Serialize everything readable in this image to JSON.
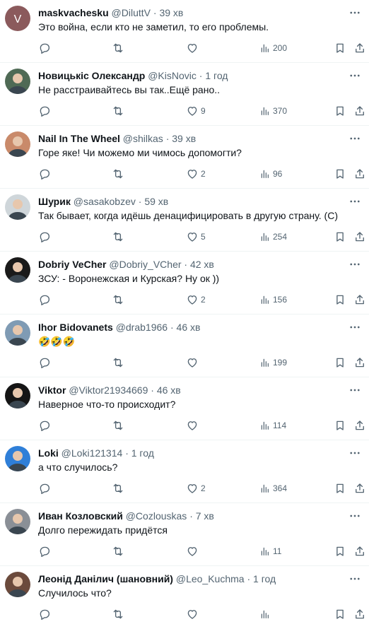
{
  "replies": [
    {
      "name": "maskvachesku",
      "handle": "@DiluttV",
      "sep": "·",
      "time": "39 хв",
      "text": "Это война, если кто не заметил, то его проблемы.",
      "reply_count": "",
      "retweet_count": "",
      "like_count": "",
      "views": "200",
      "avatar_letter": "V",
      "avatar_color": "#8b5a5c"
    },
    {
      "name": "Новицькіс Олександр",
      "handle": "@KisNovic",
      "sep": "·",
      "time": "1 год",
      "text": "Не расстраивайтесь вы так..Ещё рано..",
      "reply_count": "",
      "retweet_count": "",
      "like_count": "9",
      "views": "370",
      "avatar_color": "#4f6a55"
    },
    {
      "name": "Nail In The Wheel",
      "handle": "@shilkas",
      "sep": "·",
      "time": "39 хв",
      "text": "Горе яке! Чи можемо ми чимось допомогти?",
      "reply_count": "",
      "retweet_count": "",
      "like_count": "2",
      "views": "96",
      "avatar_color": "#c98a6a"
    },
    {
      "name": "Шурик",
      "handle": "@sasakobzev",
      "sep": "·",
      "time": "59 хв",
      "text": "Так бывает, когда идёшь денацифицировать в другую страну. (С)",
      "reply_count": "",
      "retweet_count": "",
      "like_count": "5",
      "views": "254",
      "avatar_color": "#cfd6da"
    },
    {
      "name": "Dobriy VeCher",
      "handle": "@Dobriy_VCher",
      "sep": "·",
      "time": "42 хв",
      "text": "ЗСУ: - Воронежская и Курская? Ну ок ))",
      "reply_count": "",
      "retweet_count": "",
      "like_count": "2",
      "views": "156",
      "avatar_color": "#1a1a1a"
    },
    {
      "name": "Ihor Bidovanets",
      "handle": "@drab1966",
      "sep": "·",
      "time": "46 хв",
      "text": "🤣🤣🤣",
      "reply_count": "",
      "retweet_count": "",
      "like_count": "",
      "views": "199",
      "avatar_color": "#7f9bb4"
    },
    {
      "name": "Viktor",
      "handle": "@Viktor21934669",
      "sep": "·",
      "time": "46 хв",
      "text": "Наверное что-то происходит?",
      "reply_count": "",
      "retweet_count": "",
      "like_count": "",
      "views": "114",
      "avatar_color": "#151515"
    },
    {
      "name": "Loki",
      "handle": "@Loki121314",
      "sep": "·",
      "time": "1 год",
      "text": "а что случилось?",
      "reply_count": "",
      "retweet_count": "",
      "like_count": "2",
      "views": "364",
      "avatar_color": "#2f7fd8"
    },
    {
      "name": "Иван Козловский",
      "handle": "@Cozlouskas",
      "sep": "·",
      "time": "7 хв",
      "text": "Долго пережидать придётся",
      "reply_count": "",
      "retweet_count": "",
      "like_count": "",
      "views": "11",
      "avatar_color": "#8a8f96"
    },
    {
      "name": "Леонід Данілич (шановний)",
      "handle": "@Leo_Kuchma",
      "sep": "·",
      "time": "1 год",
      "text": "Случилось что?",
      "reply_count": "",
      "retweet_count": "",
      "like_count": "",
      "views": "",
      "avatar_color": "#6b4a3c"
    }
  ]
}
